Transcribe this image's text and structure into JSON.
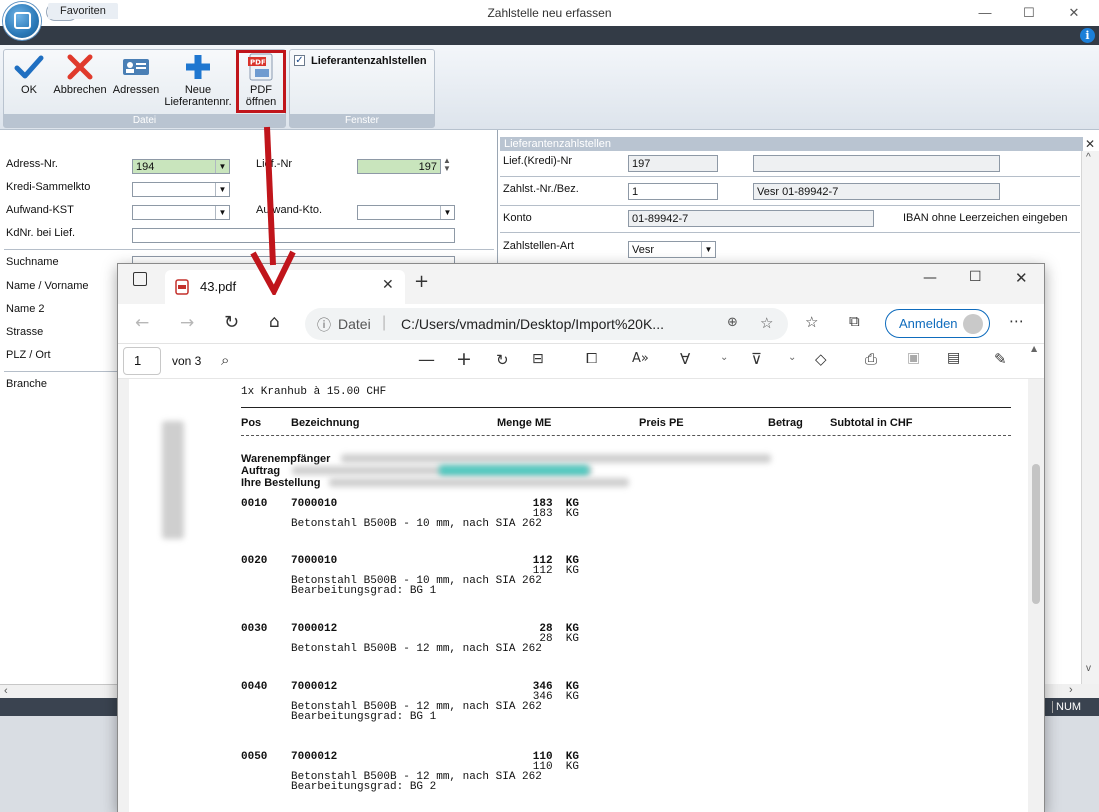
{
  "window": {
    "title": "Zahlstelle neu erfassen"
  },
  "ribbon": {
    "tabs": [
      "Favoriten",
      "Datei",
      "Fenster"
    ],
    "buttons": {
      "ok": "OK",
      "abbrechen": "Abbrechen",
      "adressen": "Adressen",
      "neue_1": "Neue",
      "neue_2": "Lieferantennr.",
      "pdf_1": "PDF",
      "pdf_2": "öffnen"
    },
    "groups": {
      "datei": "Datei",
      "fenster": "Fenster"
    },
    "checkbox_label": "Lieferantenzahlstellen"
  },
  "left_form": {
    "labels": {
      "adress_nr": "Adress-Nr.",
      "kredi": "Kredi-Sammelkto",
      "aufwand_kst": "Aufwand-KST",
      "kdnr": "KdNr. bei Lief.",
      "suchname": "Suchname",
      "name_vorname": "Name / Vorname",
      "name2": "Name 2",
      "strasse": "Strasse",
      "plz_ort": "PLZ / Ort",
      "branche": "Branche",
      "lief_nr": "Lief.-Nr",
      "aufwand_kto": "Aufwand-Kto."
    },
    "values": {
      "adress_nr": "194",
      "lief_nr": "197"
    }
  },
  "right_panel": {
    "title": "Lieferantenzahlstellen",
    "labels": {
      "lief_kredi": "Lief.(Kredi)-Nr",
      "zahlst": "Zahlst.-Nr./Bez.",
      "konto": "Konto",
      "art": "Zahlstellen-Art",
      "iban_hint": "IBAN ohne Leerzeichen eingeben"
    },
    "values": {
      "lief_kredi": "197",
      "zahlst_nr": "1",
      "zahlst_bez": "Vesr 01-89942-7",
      "konto": "01-89942-7",
      "art": "Vesr"
    }
  },
  "status": {
    "num": "NUM"
  },
  "browser": {
    "tab_title": "43.pdf",
    "address_prefix": "Datei",
    "address": "C:/Users/vmadmin/Desktop/Import%20K...",
    "signin": "Anmelden",
    "page_number": "1",
    "page_total": "von 3"
  },
  "pdf": {
    "top_line": "1x Kranhub à 15.00 CHF",
    "headers": {
      "pos": "Pos",
      "bez": "Bezeichnung",
      "menge": "Menge ME",
      "preis": "Preis PE",
      "betrag": "Betrag",
      "subtotal": "Subtotal in CHF"
    },
    "meta": {
      "waren": "Warenempfänger",
      "auftrag": "Auftrag",
      "bestellung": "Ihre Bestellung"
    },
    "items": [
      {
        "pos": "0010",
        "art": "7000010",
        "qty1": "183  KG",
        "qty2": "183  KG",
        "desc": "Betonstahl B500B - 10 mm, nach SIA 262",
        "grad": ""
      },
      {
        "pos": "0020",
        "art": "7000010",
        "qty1": "112  KG",
        "qty2": "112  KG",
        "desc": "Betonstahl B500B - 10 mm, nach SIA 262",
        "grad": "Bearbeitungsgrad: BG 1"
      },
      {
        "pos": "0030",
        "art": "7000012",
        "qty1": "28  KG",
        "qty2": "28  KG",
        "desc": "Betonstahl B500B - 12 mm, nach SIA 262",
        "grad": ""
      },
      {
        "pos": "0040",
        "art": "7000012",
        "qty1": "346  KG",
        "qty2": "346  KG",
        "desc": "Betonstahl B500B - 12 mm, nach SIA 262",
        "grad": "Bearbeitungsgrad: BG 1"
      },
      {
        "pos": "0050",
        "art": "7000012",
        "qty1": "110  KG",
        "qty2": "110  KG",
        "desc": "Betonstahl B500B - 12 mm, nach SIA 262",
        "grad": "Bearbeitungsgrad: BG 2"
      }
    ]
  },
  "colors": {
    "accent_red": "#c0151b",
    "ribbon_dark": "#333b46",
    "edge_blue": "#0f6cbd"
  }
}
